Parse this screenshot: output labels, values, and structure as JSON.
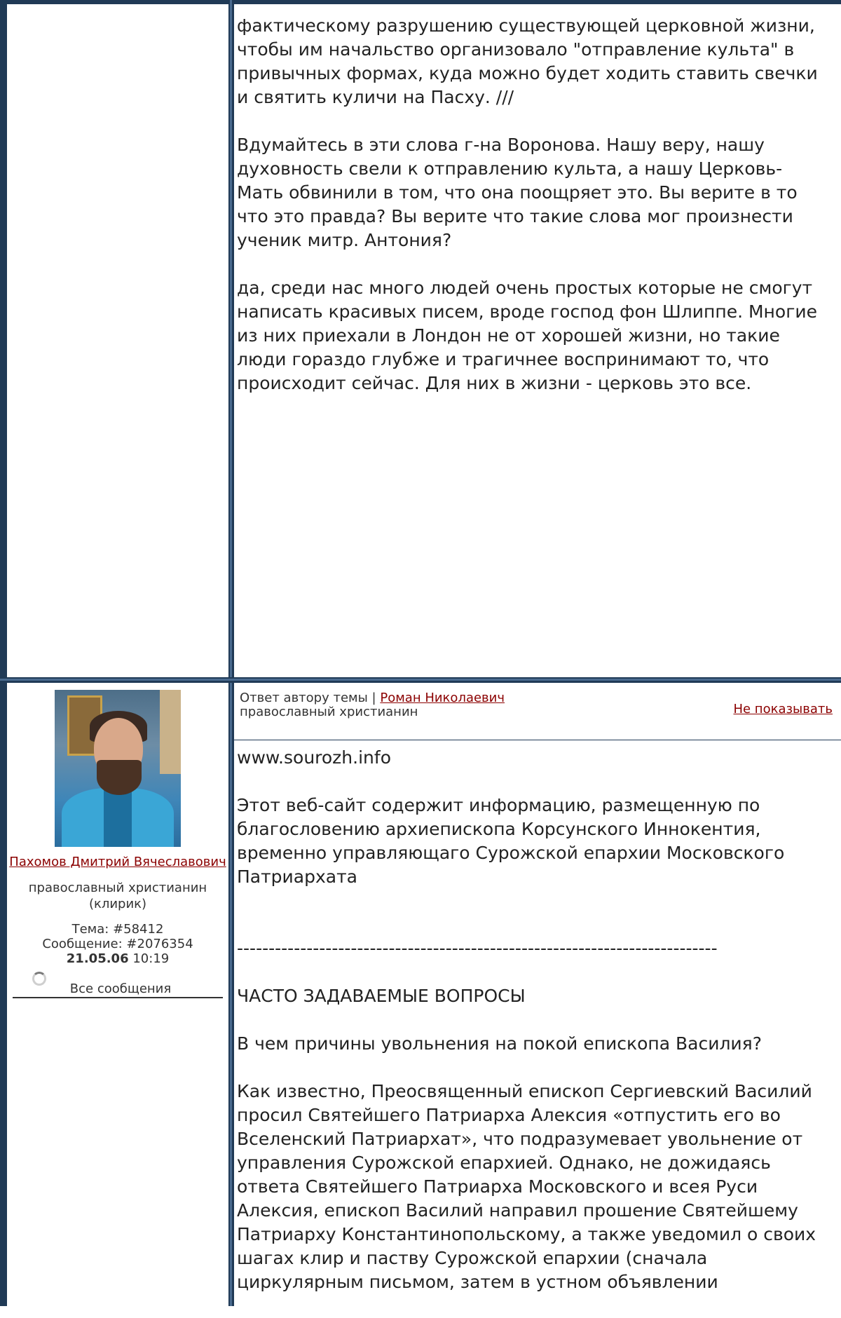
{
  "post1": {
    "paragraphs": [
      "фактическому разрушению существующей церковной жизни, чтобы им начальство организовало \"отправление культа\" в привычных формах, куда можно будет ходить ставить свечки и святить куличи на Пасху. ///",
      "Вдумайтесь в эти слова г-на Воронова. Нашу веру, нашу духовность свели к отправлению культа, а нашу Церковь-Мать обвинили в том, что она поощряет это. Вы верите в то что это правда? Вы верите что такие слова мог произнести ученик митр. Антония?",
      "да, среди нас много людей очень простых которые не смогут написать красивых писем, вроде господ фон Шлиппе. Многие из них приехали в Лондон не от хорошей жизни, но такие люди гораздо глубже и трагичнее воспринимают то, что происходит сейчас. Для них в жизни - церковь это все."
    ]
  },
  "post2": {
    "author": {
      "avatar_icon": "user-photo",
      "name": "Пахомов Дмитрий Вячеславович",
      "role": "православный христианин (клирик)",
      "topic_label": "Тема:",
      "topic_id": "#58412",
      "message_label": "Сообщение:",
      "message_id": "#2076354",
      "date": "21.05.06",
      "time": "10:19",
      "all_messages": "Все сообщения"
    },
    "header": {
      "reply_prefix": "Ответ автору темы |",
      "reply_to_name": "Роман Николаевич",
      "reply_to_role": "православный христианин",
      "hide_link": "Не показывать"
    },
    "body": {
      "site": "www.sourozh.info",
      "intro": "Этот веб-сайт содержит информацию, размещенную по благословению архиепископа Корсунского Иннокентия, временно управляющаго Сурожской епархии Московского Патриархата",
      "separator": "----------------------------------------------------------------------------",
      "faq_title": "ЧАСТО ЗАДАВАЕМЫЕ ВОПРОСЫ",
      "question": "В чем причины увольнения на покой епископа Василия?",
      "answer": "Как известно, Преосвященный епископ Сергиевский Василий просил Святейшего Патриарха Алексия «отпустить его во Вселенский Патриархат», что подразумевает увольнение от управления Сурожской епархией. Однако, не дожидаясь ответа Святейшего Патриарха Московского и всея Руси Алексия, епископ Василий направил прошение Святейшему Патриарху Константинопольскому, а также уведомил о своих шагах клир и паству Сурожской епархии (сначала циркулярным письмом, затем в устном объявлении"
    }
  },
  "colors": {
    "frame": "#203a56",
    "link": "#8b0000",
    "text": "#222222"
  }
}
